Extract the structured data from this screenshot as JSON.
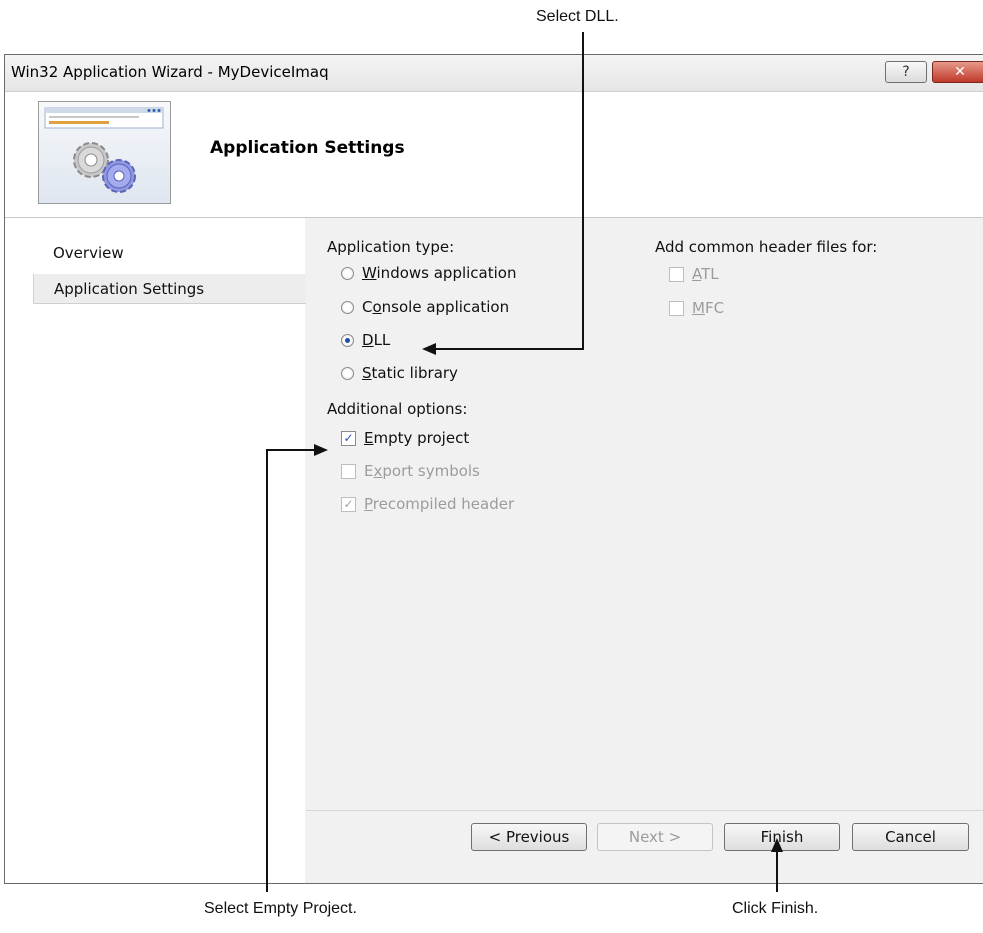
{
  "callouts": {
    "select_dll": "Select DLL.",
    "select_empty_project": "Select Empty Project.",
    "click_finish": "Click Finish."
  },
  "window": {
    "title": "Win32 Application Wizard - MyDeviceImaq",
    "help_label": "?",
    "close_label": "✕"
  },
  "header": {
    "title": "Application Settings"
  },
  "nav": {
    "items": [
      {
        "label": "Overview"
      },
      {
        "label": "Application Settings"
      }
    ]
  },
  "application_type": {
    "label": "Application type:",
    "options": [
      {
        "mnemonic": "W",
        "rest": "indows application",
        "checked": false
      },
      {
        "pre": "C",
        "mnemonic": "o",
        "rest": "nsole application",
        "checked": false
      },
      {
        "mnemonic": "D",
        "rest": "LL",
        "checked": true
      },
      {
        "mnemonic": "S",
        "rest": "tatic library",
        "checked": false
      }
    ]
  },
  "additional_options": {
    "label": "Additional options:",
    "options": [
      {
        "mnemonic": "E",
        "rest": "mpty project",
        "checked": true,
        "enabled": true
      },
      {
        "pre": "E",
        "mnemonic": "x",
        "rest": "port symbols",
        "checked": false,
        "enabled": false
      },
      {
        "mnemonic": "P",
        "rest": "recompiled header",
        "checked": true,
        "enabled": false
      }
    ]
  },
  "header_files": {
    "label": "Add common header files for:",
    "options": [
      {
        "mnemonic": "A",
        "rest": "TL",
        "checked": false,
        "enabled": false
      },
      {
        "mnemonic": "M",
        "rest": "FC",
        "checked": false,
        "enabled": false
      }
    ]
  },
  "footer": {
    "previous_label": "< Previous",
    "next_label": "Next >",
    "finish_label": "Finish",
    "cancel_label": "Cancel"
  },
  "colors": {
    "window_bg": "#f1f1f1",
    "close_button": "#c0392b",
    "radio_dot": "#1c4f9c",
    "disabled_text": "#9c9c9c"
  }
}
